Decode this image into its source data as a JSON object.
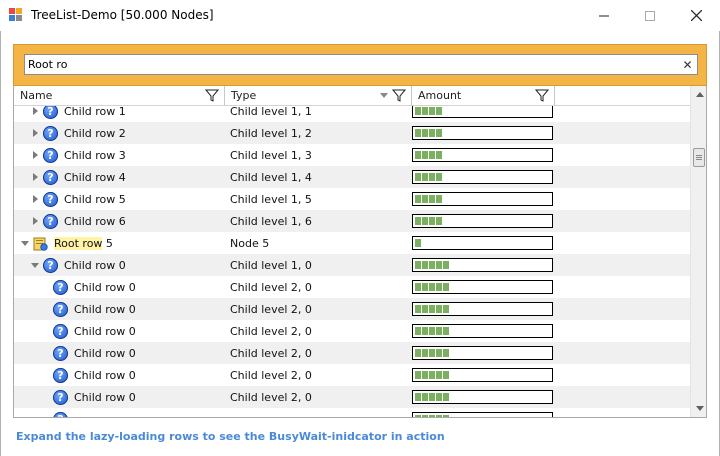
{
  "window": {
    "title": "TreeList-Demo [50.000 Nodes]",
    "controls": [
      "minimize",
      "maximize",
      "close"
    ]
  },
  "search": {
    "value": "Root ro",
    "clear_label": "✕"
  },
  "columns": [
    {
      "label": "Name"
    },
    {
      "label": "Type"
    },
    {
      "label": "Amount"
    }
  ],
  "rows": [
    {
      "name": "Child row 1",
      "type": "Child level 1, 1",
      "level": 1,
      "expander": "collapsed",
      "icon": "question-icon",
      "amount": 0.23
    },
    {
      "name": "Child row 2",
      "type": "Child level 1, 2",
      "level": 1,
      "expander": "collapsed",
      "icon": "question-icon",
      "amount": 0.23
    },
    {
      "name": "Child row 3",
      "type": "Child level 1, 3",
      "level": 1,
      "expander": "collapsed",
      "icon": "question-icon",
      "amount": 0.23
    },
    {
      "name": "Child row 4",
      "type": "Child level 1, 4",
      "level": 1,
      "expander": "collapsed",
      "icon": "question-icon",
      "amount": 0.23
    },
    {
      "name": "Child row 5",
      "type": "Child level 1, 5",
      "level": 1,
      "expander": "collapsed",
      "icon": "question-icon",
      "amount": 0.23
    },
    {
      "name": "Child row 6",
      "type": "Child level 1, 6",
      "level": 1,
      "expander": "collapsed",
      "icon": "question-icon",
      "amount": 0.23
    },
    {
      "name_highlight": "Root row",
      "name_rest": " 5",
      "type": "Node 5",
      "level": 0,
      "expander": "expanded",
      "icon": "root-node-icon",
      "amount": 0.03
    },
    {
      "name": "Child row 0",
      "type": "Child level 1, 0",
      "level": 1,
      "expander": "expanded",
      "icon": "question-icon",
      "amount": 0.3
    },
    {
      "name": "Child row 0",
      "type": "Child level 2, 0",
      "level": 2,
      "expander": "none",
      "icon": "question-icon",
      "amount": 0.3
    },
    {
      "name": "Child row 0",
      "type": "Child level 2, 0",
      "level": 2,
      "expander": "none",
      "icon": "question-icon",
      "amount": 0.3
    },
    {
      "name": "Child row 0",
      "type": "Child level 2, 0",
      "level": 2,
      "expander": "none",
      "icon": "question-icon",
      "amount": 0.3
    },
    {
      "name": "Child row 0",
      "type": "Child level 2, 0",
      "level": 2,
      "expander": "none",
      "icon": "question-icon",
      "amount": 0.3
    },
    {
      "name": "Child row 0",
      "type": "Child level 2, 0",
      "level": 2,
      "expander": "none",
      "icon": "question-icon",
      "amount": 0.3
    },
    {
      "name": "Child row 0",
      "type": "Child level 2, 0",
      "level": 2,
      "expander": "none",
      "icon": "question-icon",
      "amount": 0.3
    },
    {
      "name": "",
      "type": "",
      "level": 2,
      "expander": "none",
      "icon": "question-icon",
      "amount": 0.3
    }
  ],
  "footer": {
    "text": "Expand the lazy-loading rows to see the BusyWait-inidcator in action"
  },
  "colors": {
    "search_band": "#f4b446",
    "amount_fill": "#7ab060",
    "footer_link": "#4a8ad8",
    "highlight": "#fff3a6"
  }
}
